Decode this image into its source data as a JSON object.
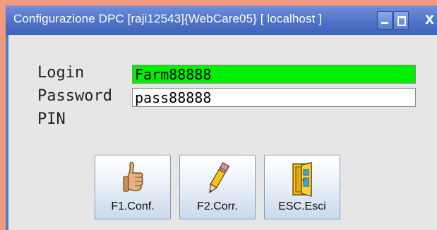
{
  "window": {
    "title": "Configurazione DPC [raji12543]{WebCare05} [ localhost ]",
    "close_label": "X"
  },
  "form": {
    "login": {
      "label": "Login",
      "value": "Farm88888"
    },
    "password": {
      "label": "Password",
      "value": "pass88888"
    },
    "pin": {
      "label": "PIN"
    }
  },
  "buttons": {
    "conf": {
      "label": "F1.Conf.",
      "icon": "thumbs-up-icon"
    },
    "corr": {
      "label": "F2.Corr.",
      "icon": "pencil-icon"
    },
    "esci": {
      "label": "ESC.Esci",
      "icon": "door-exit-icon"
    }
  },
  "colors": {
    "titlebar": "#4f72c6",
    "login_field_bg": "#00ee00",
    "client_bg": "#e6e6e6"
  }
}
